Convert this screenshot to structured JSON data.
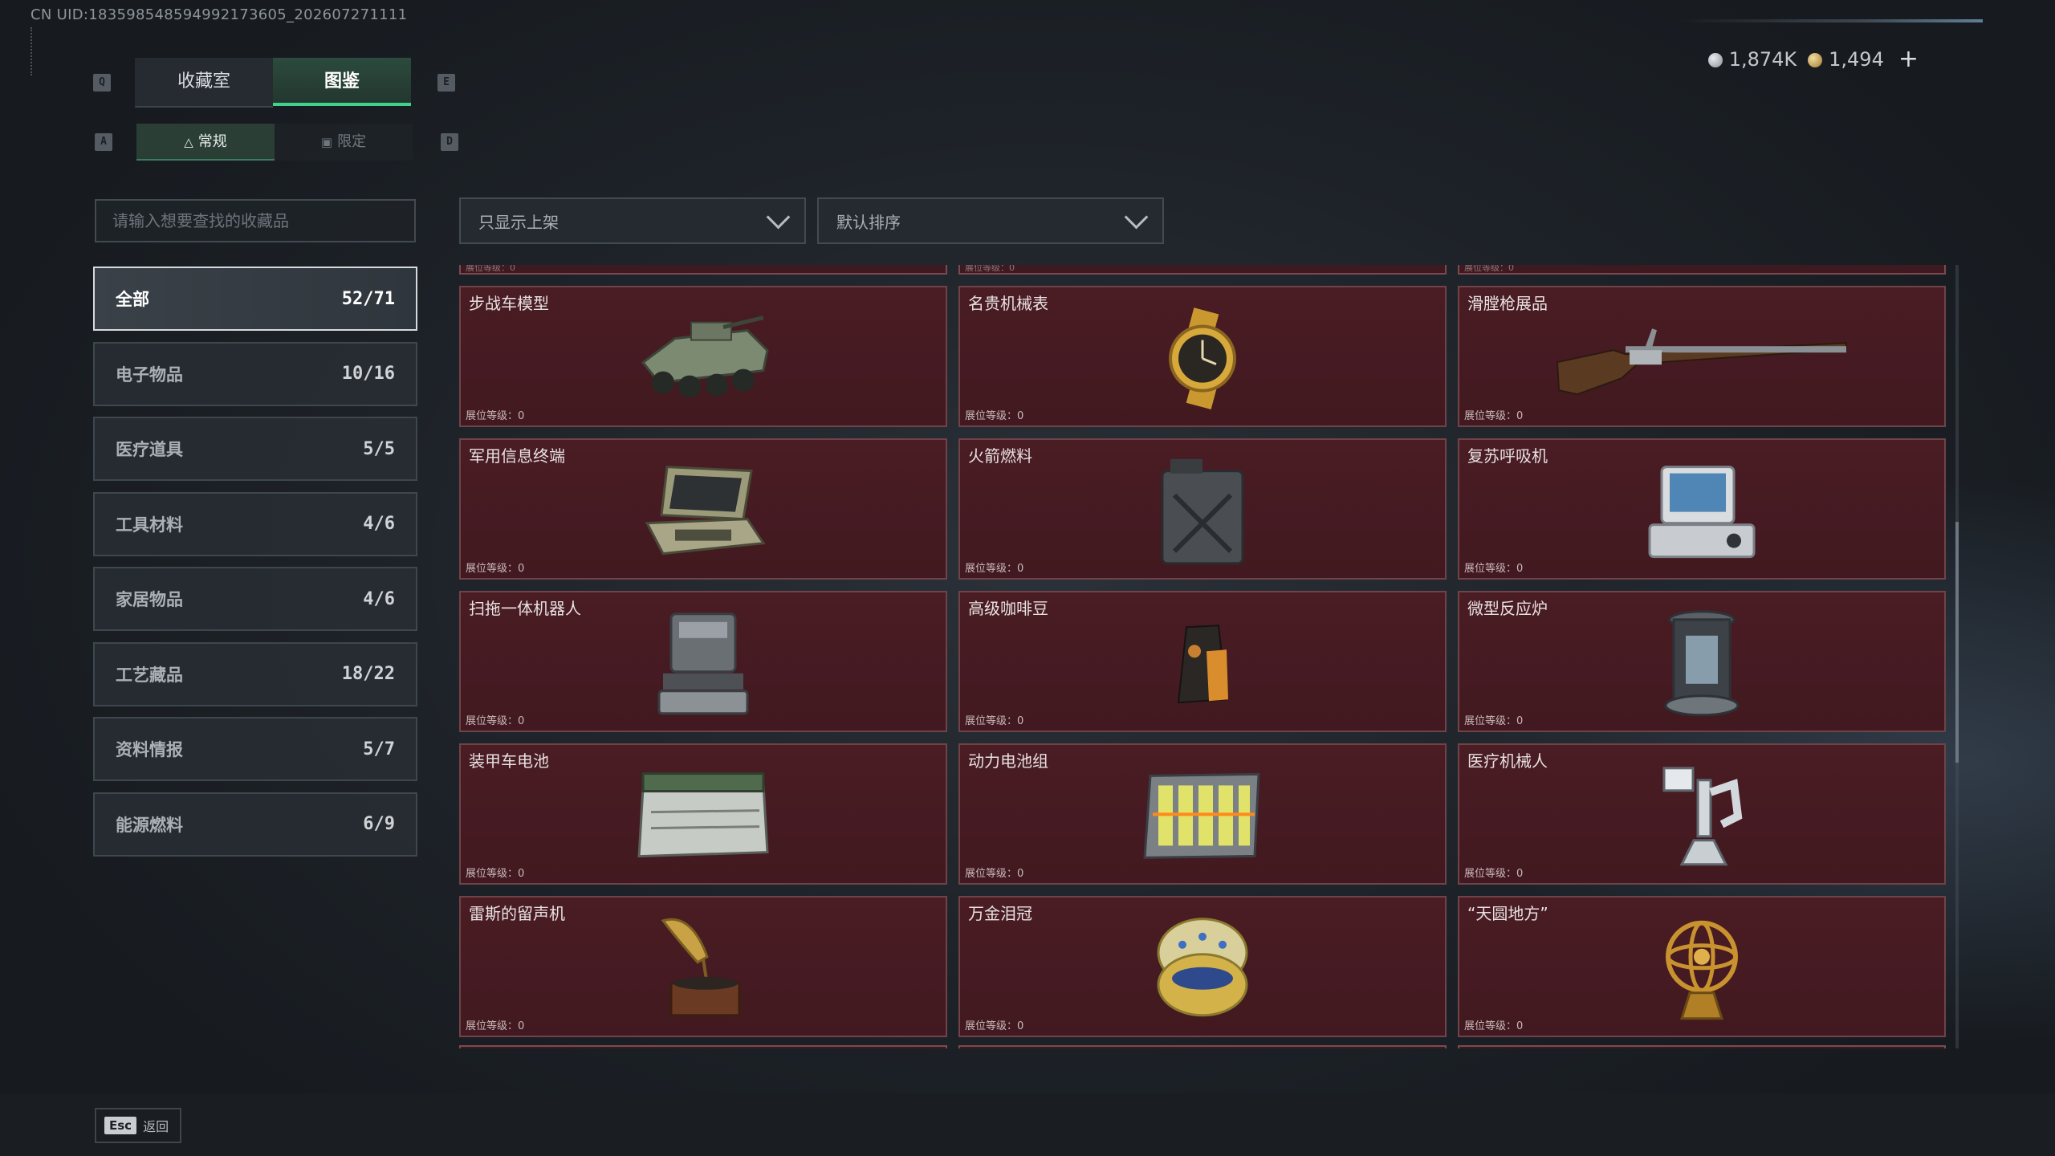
{
  "header": {
    "uid": "CN UID:183598548594992173605_202607271111"
  },
  "currency": [
    {
      "icon": "silver-coin-icon",
      "value": "1,874K"
    },
    {
      "icon": "gold-coin-icon",
      "value": "1,494"
    }
  ],
  "currency_plus": "+",
  "keys": {
    "q": "Q",
    "e": "E",
    "a": "A",
    "d": "D",
    "esc": "Esc"
  },
  "main_tabs": [
    {
      "label": "收藏室"
    },
    {
      "label": "图鉴"
    }
  ],
  "sub_tabs": [
    {
      "label": "常规"
    },
    {
      "label": "限定"
    }
  ],
  "search": {
    "placeholder": "请输入想要查找的收藏品"
  },
  "filters": {
    "shelf": "只显示上架",
    "sort": "默认排序"
  },
  "categories": [
    {
      "label": "全部",
      "count": "52/71"
    },
    {
      "label": "电子物品",
      "count": "10/16"
    },
    {
      "label": "医疗道具",
      "count": "5/5"
    },
    {
      "label": "工具材料",
      "count": "4/6"
    },
    {
      "label": "家居物品",
      "count": "4/6"
    },
    {
      "label": "工艺藏品",
      "count": "18/22"
    },
    {
      "label": "资料情报",
      "count": "5/7"
    },
    {
      "label": "能源燃料",
      "count": "6/9"
    }
  ],
  "level_label": "展位等级：0",
  "items": [
    {
      "name": "步战车模型",
      "icon": "ifv-model-icon"
    },
    {
      "name": "名贵机械表",
      "icon": "luxury-watch-icon"
    },
    {
      "name": "滑膛枪展品",
      "icon": "musket-icon"
    },
    {
      "name": "军用信息终端",
      "icon": "military-terminal-icon"
    },
    {
      "name": "火箭燃料",
      "icon": "fuel-can-icon"
    },
    {
      "name": "复苏呼吸机",
      "icon": "ventilator-icon"
    },
    {
      "name": "扫拖一体机器人",
      "icon": "mop-robot-icon"
    },
    {
      "name": "高级咖啡豆",
      "icon": "coffee-bag-icon"
    },
    {
      "name": "微型反应炉",
      "icon": "mini-reactor-icon"
    },
    {
      "name": "装甲车电池",
      "icon": "armored-battery-icon"
    },
    {
      "name": "动力电池组",
      "icon": "battery-pack-icon"
    },
    {
      "name": "医疗机械人",
      "icon": "medical-robot-icon"
    },
    {
      "name": "雷斯的留声机",
      "icon": "gramophone-icon"
    },
    {
      "name": "万金泪冠",
      "icon": "jeweled-egg-icon"
    },
    {
      "name": "“天圆地方”",
      "icon": "armillary-sphere-icon"
    }
  ],
  "footer": {
    "back_label": "返回"
  }
}
